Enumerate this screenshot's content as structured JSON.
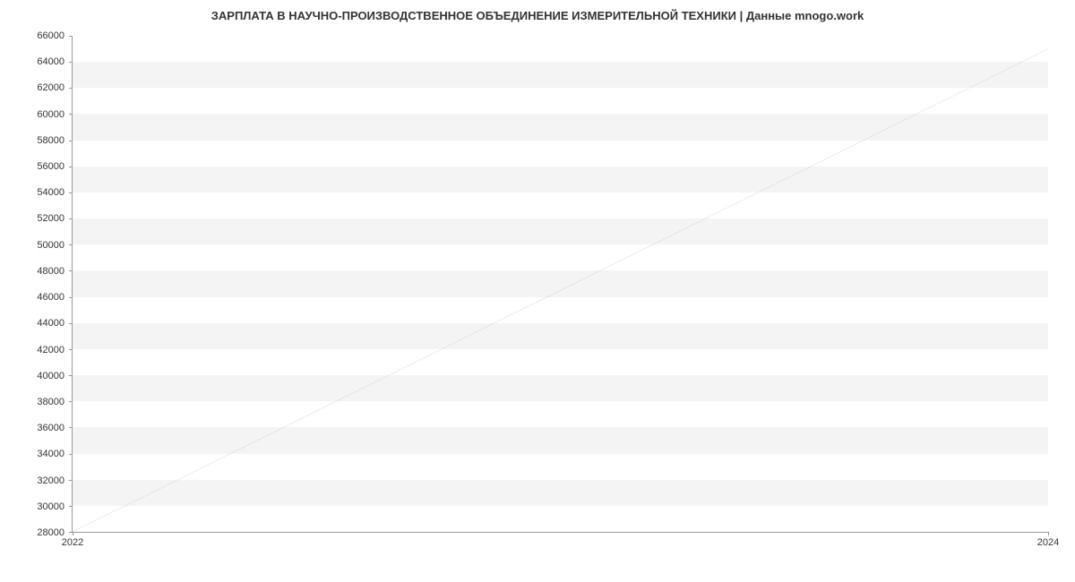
{
  "chart_data": {
    "type": "line",
    "title": "ЗАРПЛАТА В  НАУЧНО-ПРОИЗВОДСТВЕННОЕ ОБЪЕДИНЕНИЕ ИЗМЕРИТЕЛЬНОЙ ТЕХНИКИ | Данные mnogo.work",
    "x": [
      2022,
      2024
    ],
    "values": [
      28000,
      65000
    ],
    "xlabel": "",
    "ylabel": "",
    "xlim": [
      2022,
      2024
    ],
    "ylim": [
      28000,
      66000
    ],
    "y_ticks": [
      28000,
      30000,
      32000,
      34000,
      36000,
      38000,
      40000,
      42000,
      44000,
      46000,
      48000,
      50000,
      52000,
      54000,
      56000,
      58000,
      60000,
      62000,
      64000,
      66000
    ],
    "x_ticks": [
      2022,
      2024
    ],
    "line_color": "#7cb5ec",
    "band_color": "#f4f4f4"
  }
}
